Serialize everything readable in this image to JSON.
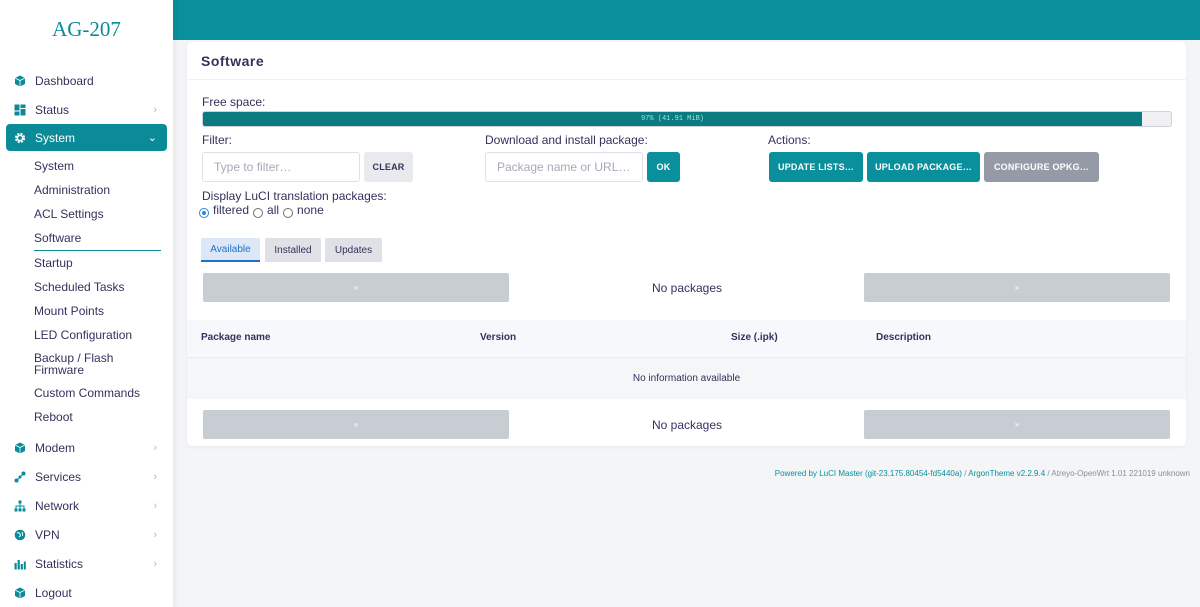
{
  "brand": "AG-207",
  "sidebar": {
    "items_top": [
      {
        "label": "Dashboard",
        "icon": "cube-icon"
      },
      {
        "label": "Status",
        "icon": "grid-icon"
      }
    ],
    "active": {
      "label": "System",
      "icon": "gear-icon"
    },
    "subitems": [
      "System",
      "Administration",
      "ACL Settings",
      "Software",
      "Startup",
      "Scheduled Tasks",
      "Mount Points",
      "LED Configuration",
      "Backup / Flash Firmware",
      "Custom Commands",
      "Reboot"
    ],
    "current_subitem": "Software",
    "items_bottom": [
      {
        "label": "Modem",
        "icon": "cube-icon"
      },
      {
        "label": "Services",
        "icon": "share-icon"
      },
      {
        "label": "Network",
        "icon": "network-icon"
      },
      {
        "label": "VPN",
        "icon": "globe-icon"
      },
      {
        "label": "Statistics",
        "icon": "bar-chart-icon"
      },
      {
        "label": "Logout",
        "icon": "cube-icon"
      }
    ]
  },
  "page": {
    "title": "Software",
    "free_space_label": "Free space:",
    "free_space_text": "97% (41.91 MiB)",
    "free_space_fraction": 0.97,
    "filter_label": "Filter:",
    "filter_placeholder": "Type to filter…",
    "clear_label": "CLEAR",
    "download_label": "Download and install package:",
    "download_placeholder": "Package name or URL…",
    "ok_label": "OK",
    "actions_label": "Actions:",
    "update_lists_label": "UPDATE LISTS…",
    "upload_package_label": "UPLOAD PACKAGE…",
    "configure_opkg_label": "CONFIGURE OPKG…",
    "translation_label": "Display LuCI translation packages:",
    "translation_options": [
      "filtered",
      "all",
      "none"
    ],
    "translation_selected": "filtered",
    "tabs": [
      "Available",
      "Installed",
      "Updates"
    ],
    "active_tab": "Available",
    "pager_prev_glyph": "«",
    "pager_next_glyph": "»",
    "no_packages_text": "No packages",
    "columns": [
      "Package name",
      "Version",
      "Size (.ipk)",
      "Description"
    ],
    "no_info_text": "No information available"
  },
  "footer": {
    "luci_link": "Powered by LuCI Master (git-23.175.80454-fd5440a)",
    "sep1": " / ",
    "theme_link": "ArgonTheme v2.2.9.4",
    "sep2": " / ",
    "firmware": "Atreyo-OpenWrt 1.01 221019 unknown"
  },
  "colors": {
    "accent": "#0a8f9c",
    "progress_fill": "#0a7b80",
    "tab_active": "#1a73c9"
  }
}
